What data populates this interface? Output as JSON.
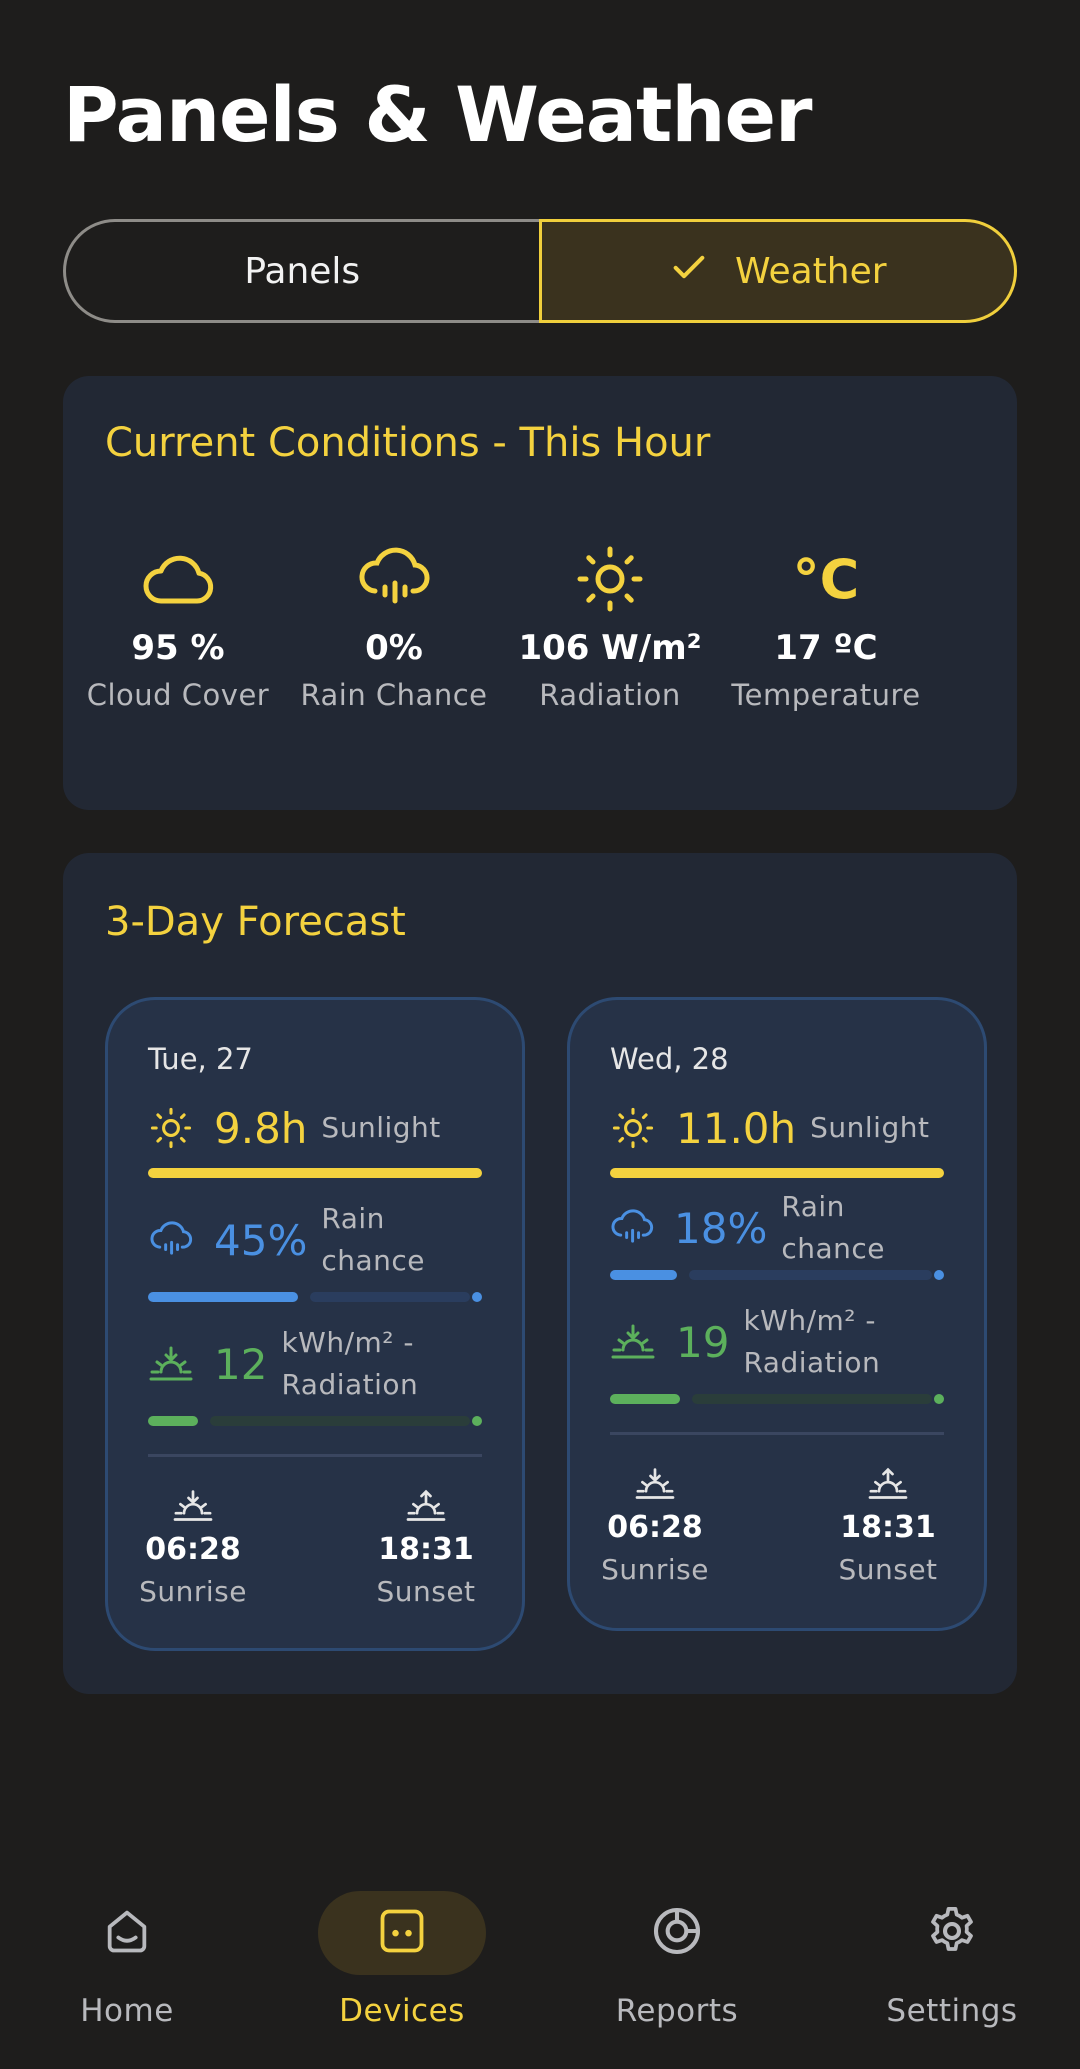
{
  "header": {
    "title": "Panels & Weather"
  },
  "segments": [
    {
      "label": "Panels",
      "selected": false
    },
    {
      "label": "Weather",
      "selected": true
    }
  ],
  "current": {
    "title": "Current Conditions - This Hour",
    "items": [
      {
        "icon": "cloud-icon",
        "value": "95 %",
        "label": "Cloud Cover"
      },
      {
        "icon": "rain-cloud-icon",
        "value": "0%",
        "label": "Rain Chance"
      },
      {
        "icon": "sun-icon",
        "value": "106 W/m²",
        "label": "Radiation"
      },
      {
        "icon": "celsius-icon",
        "value": "17 ºC",
        "label": "Temperature",
        "glyph": "°C"
      }
    ]
  },
  "forecast": {
    "title": "3-Day Forecast",
    "days": [
      {
        "date": "Tue, 27",
        "sunlight_value": "9.8h",
        "sunlight_label": "Sunlight",
        "sunlight_fraction": 1.0,
        "rain_value": "45%",
        "rain_label": "Rain chance",
        "rain_fraction": 0.45,
        "radiation_value": "12",
        "radiation_label": "kWh/m² - Radiation",
        "radiation_fraction": 0.15,
        "sunrise_time": "06:28",
        "sunrise_label": "Sunrise",
        "sunset_time": "18:31",
        "sunset_label": "Sunset"
      },
      {
        "date": "Wed, 28",
        "sunlight_value": "11.0h",
        "sunlight_label": "Sunlight",
        "sunlight_fraction": 1.0,
        "rain_value": "18%",
        "rain_label": "Rain chance",
        "rain_fraction": 0.2,
        "radiation_value": "19",
        "radiation_label": "kWh/m² - Radiation",
        "radiation_fraction": 0.21,
        "sunrise_time": "06:28",
        "sunrise_label": "Sunrise",
        "sunset_time": "18:31",
        "sunset_label": "Sunset"
      }
    ]
  },
  "nav": [
    {
      "label": "Home",
      "icon": "home-icon",
      "active": false
    },
    {
      "label": "Devices",
      "icon": "devices-icon",
      "active": true
    },
    {
      "label": "Reports",
      "icon": "reports-icon",
      "active": false
    },
    {
      "label": "Settings",
      "icon": "gear-icon",
      "active": false
    }
  ],
  "colors": {
    "background": "#1e1d1c",
    "accent": "#f4d23f",
    "card": "#222834",
    "rain": "#4a90e2",
    "radiation": "#5cb05c",
    "sunlight": "#f4d23f"
  }
}
